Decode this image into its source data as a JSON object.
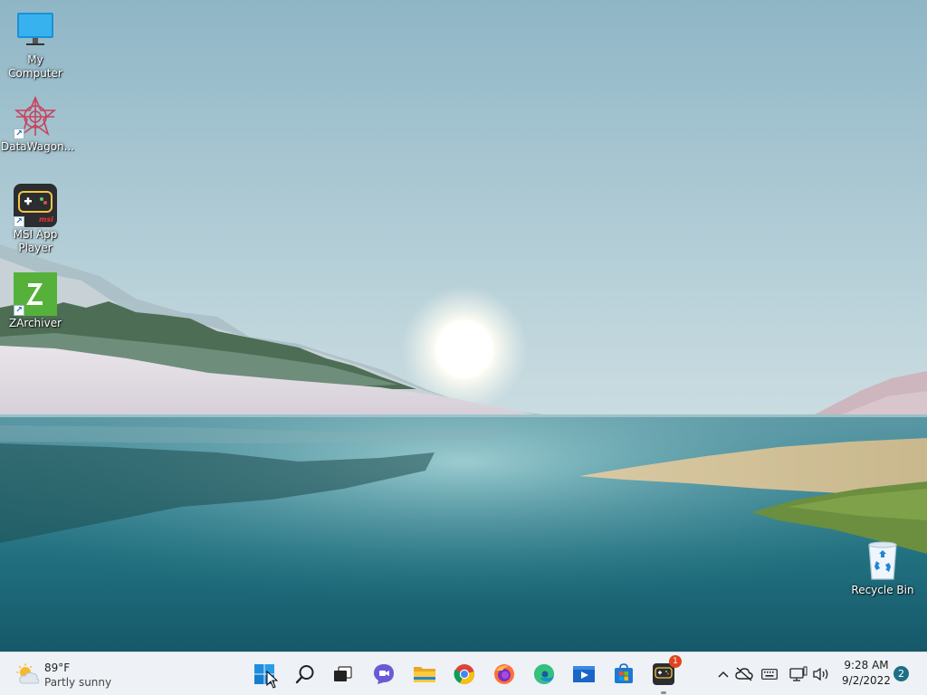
{
  "desktop": {
    "icons": [
      {
        "label": "My Computer",
        "icon": "monitor-icon"
      },
      {
        "label": "DataWagon...",
        "icon": "datawagon-icon"
      },
      {
        "label": "MSI App Player",
        "icon": "msi-app-player-icon"
      },
      {
        "label": "ZArchiver",
        "icon": "zarchiver-icon"
      },
      {
        "label": "Recycle Bin",
        "icon": "recycle-bin-icon"
      }
    ]
  },
  "taskbar": {
    "weather": {
      "temp": "89°F",
      "condition": "Partly sunny",
      "icon": "partly-sunny-icon"
    },
    "apps": [
      {
        "name": "start",
        "icon": "windows-start-icon"
      },
      {
        "name": "search",
        "icon": "search-icon"
      },
      {
        "name": "task-view",
        "icon": "task-view-icon"
      },
      {
        "name": "chat",
        "icon": "chat-icon"
      },
      {
        "name": "file-explorer",
        "icon": "folder-icon"
      },
      {
        "name": "chrome",
        "icon": "chrome-icon"
      },
      {
        "name": "firefox",
        "icon": "firefox-icon"
      },
      {
        "name": "edge",
        "icon": "edge-icon"
      },
      {
        "name": "video-player",
        "icon": "video-icon"
      },
      {
        "name": "store",
        "icon": "store-icon"
      },
      {
        "name": "msi-app-player",
        "icon": "msi-app-player-icon",
        "badge": "1"
      }
    ],
    "tray": {
      "icons": [
        "chevron-up-icon",
        "cloud-offline-icon",
        "keyboard-icon",
        "network-icon",
        "volume-icon"
      ],
      "time": "9:28 AM",
      "date": "9/2/2022",
      "notifications": "2"
    }
  }
}
